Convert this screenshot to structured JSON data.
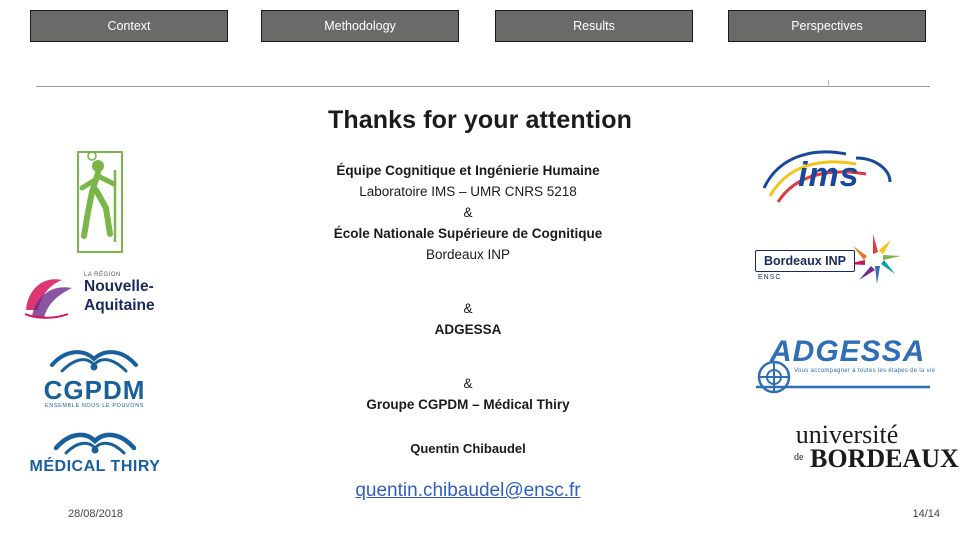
{
  "nav": {
    "tabs": [
      {
        "label": "Context"
      },
      {
        "label": "Methodology"
      },
      {
        "label": "Results"
      },
      {
        "label": "Perspectives"
      }
    ]
  },
  "slide": {
    "title": "Thanks for your attention",
    "lines": [
      {
        "text": "Équipe Cognitique et Ingénierie Humaine",
        "bold": true
      },
      {
        "text": "Laboratoire IMS – UMR CNRS 5218",
        "bold": false
      },
      {
        "text": "&",
        "bold": false
      },
      {
        "text": "École Nationale Supérieure de Cognitique",
        "bold": true
      },
      {
        "text": "Bordeaux INP",
        "bold": false
      },
      {
        "text": "&",
        "bold": false
      },
      {
        "text": "ADGESSA",
        "bold": false
      },
      {
        "text": "&",
        "bold": false
      },
      {
        "text": "Groupe CGPDM – Médical Thiry",
        "bold": true
      }
    ],
    "author": "Quentin Chibaudel",
    "email": "quentin.chibaudel@ensc.fr"
  },
  "footer": {
    "date": "28/08/2018",
    "page": "14/14"
  },
  "logos": {
    "hiker": {
      "name": "hiker-pictogram"
    },
    "aquitaine": {
      "small": "LA RÉGION",
      "line1": "Nouvelle-",
      "line2": "Aquitaine"
    },
    "cgpdm": {
      "text": "CGPDM",
      "sub": "ENSEMBLE NOUS LE POUVONS"
    },
    "thiry": {
      "text": "MÉDICAL THIRY"
    },
    "ims": {
      "text": "ims"
    },
    "bordeaux_inp": {
      "badge": "Bordeaux INP",
      "sub": "ENSC"
    },
    "adgessa": {
      "text": "ADGESSA",
      "sub": "Vous accompagner à toutes les étapes de la vie"
    },
    "universite_bordeaux": {
      "line1": "université",
      "de": "de",
      "line2": "BORDEAUX"
    }
  },
  "colors": {
    "tab_fill": "#6a6a68",
    "link": "#2f5fc0",
    "ims_blue": "#18489c",
    "cgpdm_blue": "#17609c",
    "aquitaine_blue": "#1b2a5e",
    "adgessa_blue": "#2f6fb5",
    "hiker_green": "#7ab648"
  }
}
